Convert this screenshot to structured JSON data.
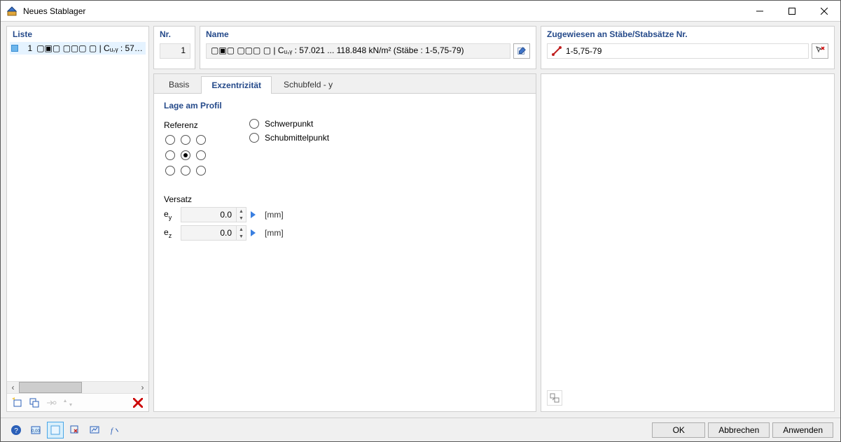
{
  "window": {
    "title": "Neues Stablager"
  },
  "left": {
    "header": "Liste",
    "items": [
      {
        "index": "1",
        "text": "▢▣▢ ▢▢▢ ▢ | Cᵤ,ᵧ : 57.021 .."
      }
    ]
  },
  "header": {
    "nr_label": "Nr.",
    "nr_value": "1",
    "name_label": "Name",
    "name_value": "▢▣▢ ▢▢▢ ▢ | Cᵤ,ᵧ : 57.021 ... 118.848 kN/m² (Stäbe : 1-5,75-79)",
    "zu_label": "Zugewiesen an Stäbe/Stabsätze Nr.",
    "zu_value": "1-5,75-79"
  },
  "tabs": {
    "basis": "Basis",
    "exz": "Exzentrizität",
    "schub": "Schubfeld - y"
  },
  "content": {
    "group_title": "Lage am Profil",
    "referenz_label": "Referenz",
    "schwerpunkt": "Schwerpunkt",
    "schubmittelpunkt": "Schubmittelpunkt",
    "versatz_label": "Versatz",
    "ey_label": "eᵧ",
    "ez_label": "e𝓏",
    "ey_value": "0.0",
    "ez_value": "0.0",
    "unit": "[mm]"
  },
  "buttons": {
    "ok": "OK",
    "cancel": "Abbrechen",
    "apply": "Anwenden"
  }
}
